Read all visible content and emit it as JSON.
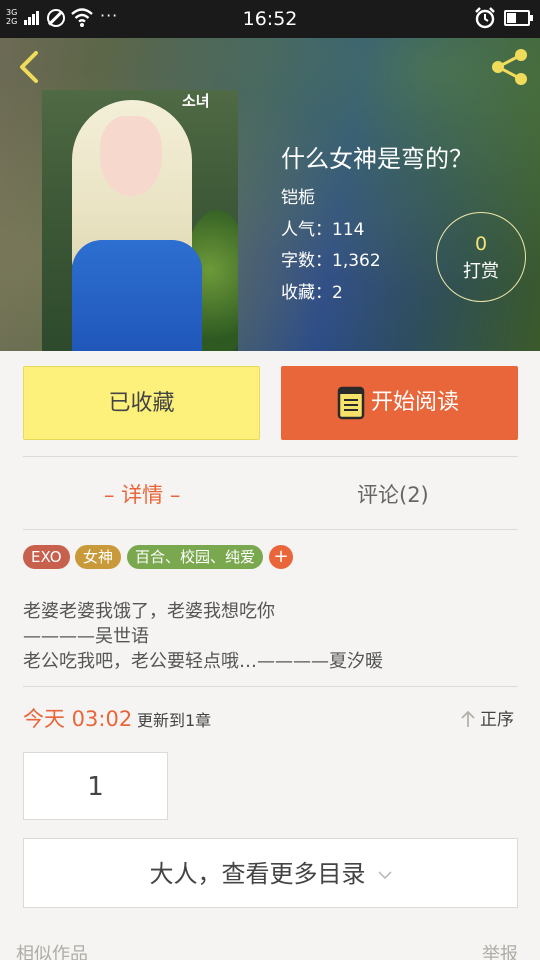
{
  "status_bar": {
    "network": "3G\n2G",
    "time": "16:52",
    "more_indicator": "···"
  },
  "header": {
    "back_icon": "chevron-left-icon",
    "share_icon": "share-icon"
  },
  "book": {
    "title": "什么女神是弯的？",
    "author": "铠栀",
    "popularity": "人气：114",
    "word_count": "字数：1,362",
    "favorites": "收藏：2",
    "cover_text": "소녀"
  },
  "reward": {
    "count": "0",
    "label": "打赏"
  },
  "actions": {
    "collected_label": "已收藏",
    "read_label": "开始阅读"
  },
  "tabs": {
    "detail": "– 详情 –",
    "comments": "评论(2)"
  },
  "tags": [
    {
      "label": "EXO",
      "color": "#c8604e"
    },
    {
      "label": "女神",
      "color": "#c99a3a"
    },
    {
      "label": "百合、校园、纯爱",
      "color": "#7aa84e"
    }
  ],
  "tag_add_label": "+",
  "description": {
    "line1": "老婆老婆我饿了，老婆我想吃你",
    "line2": "————吴世语",
    "line3": "老公吃我吧，老公要轻点哦…————夏汐暖"
  },
  "update": {
    "time": "今天 03:02",
    "info": "更新到1章",
    "sort_label": "正序"
  },
  "chapters": {
    "first": "1"
  },
  "more_catalog": {
    "label": "大人，查看更多目录"
  },
  "footer": {
    "similar": "相似作品",
    "report": "举报"
  },
  "colors": {
    "accent": "#e9663a",
    "collected_bg": "#fdf17b",
    "reward_ring": "#ede7a8"
  }
}
